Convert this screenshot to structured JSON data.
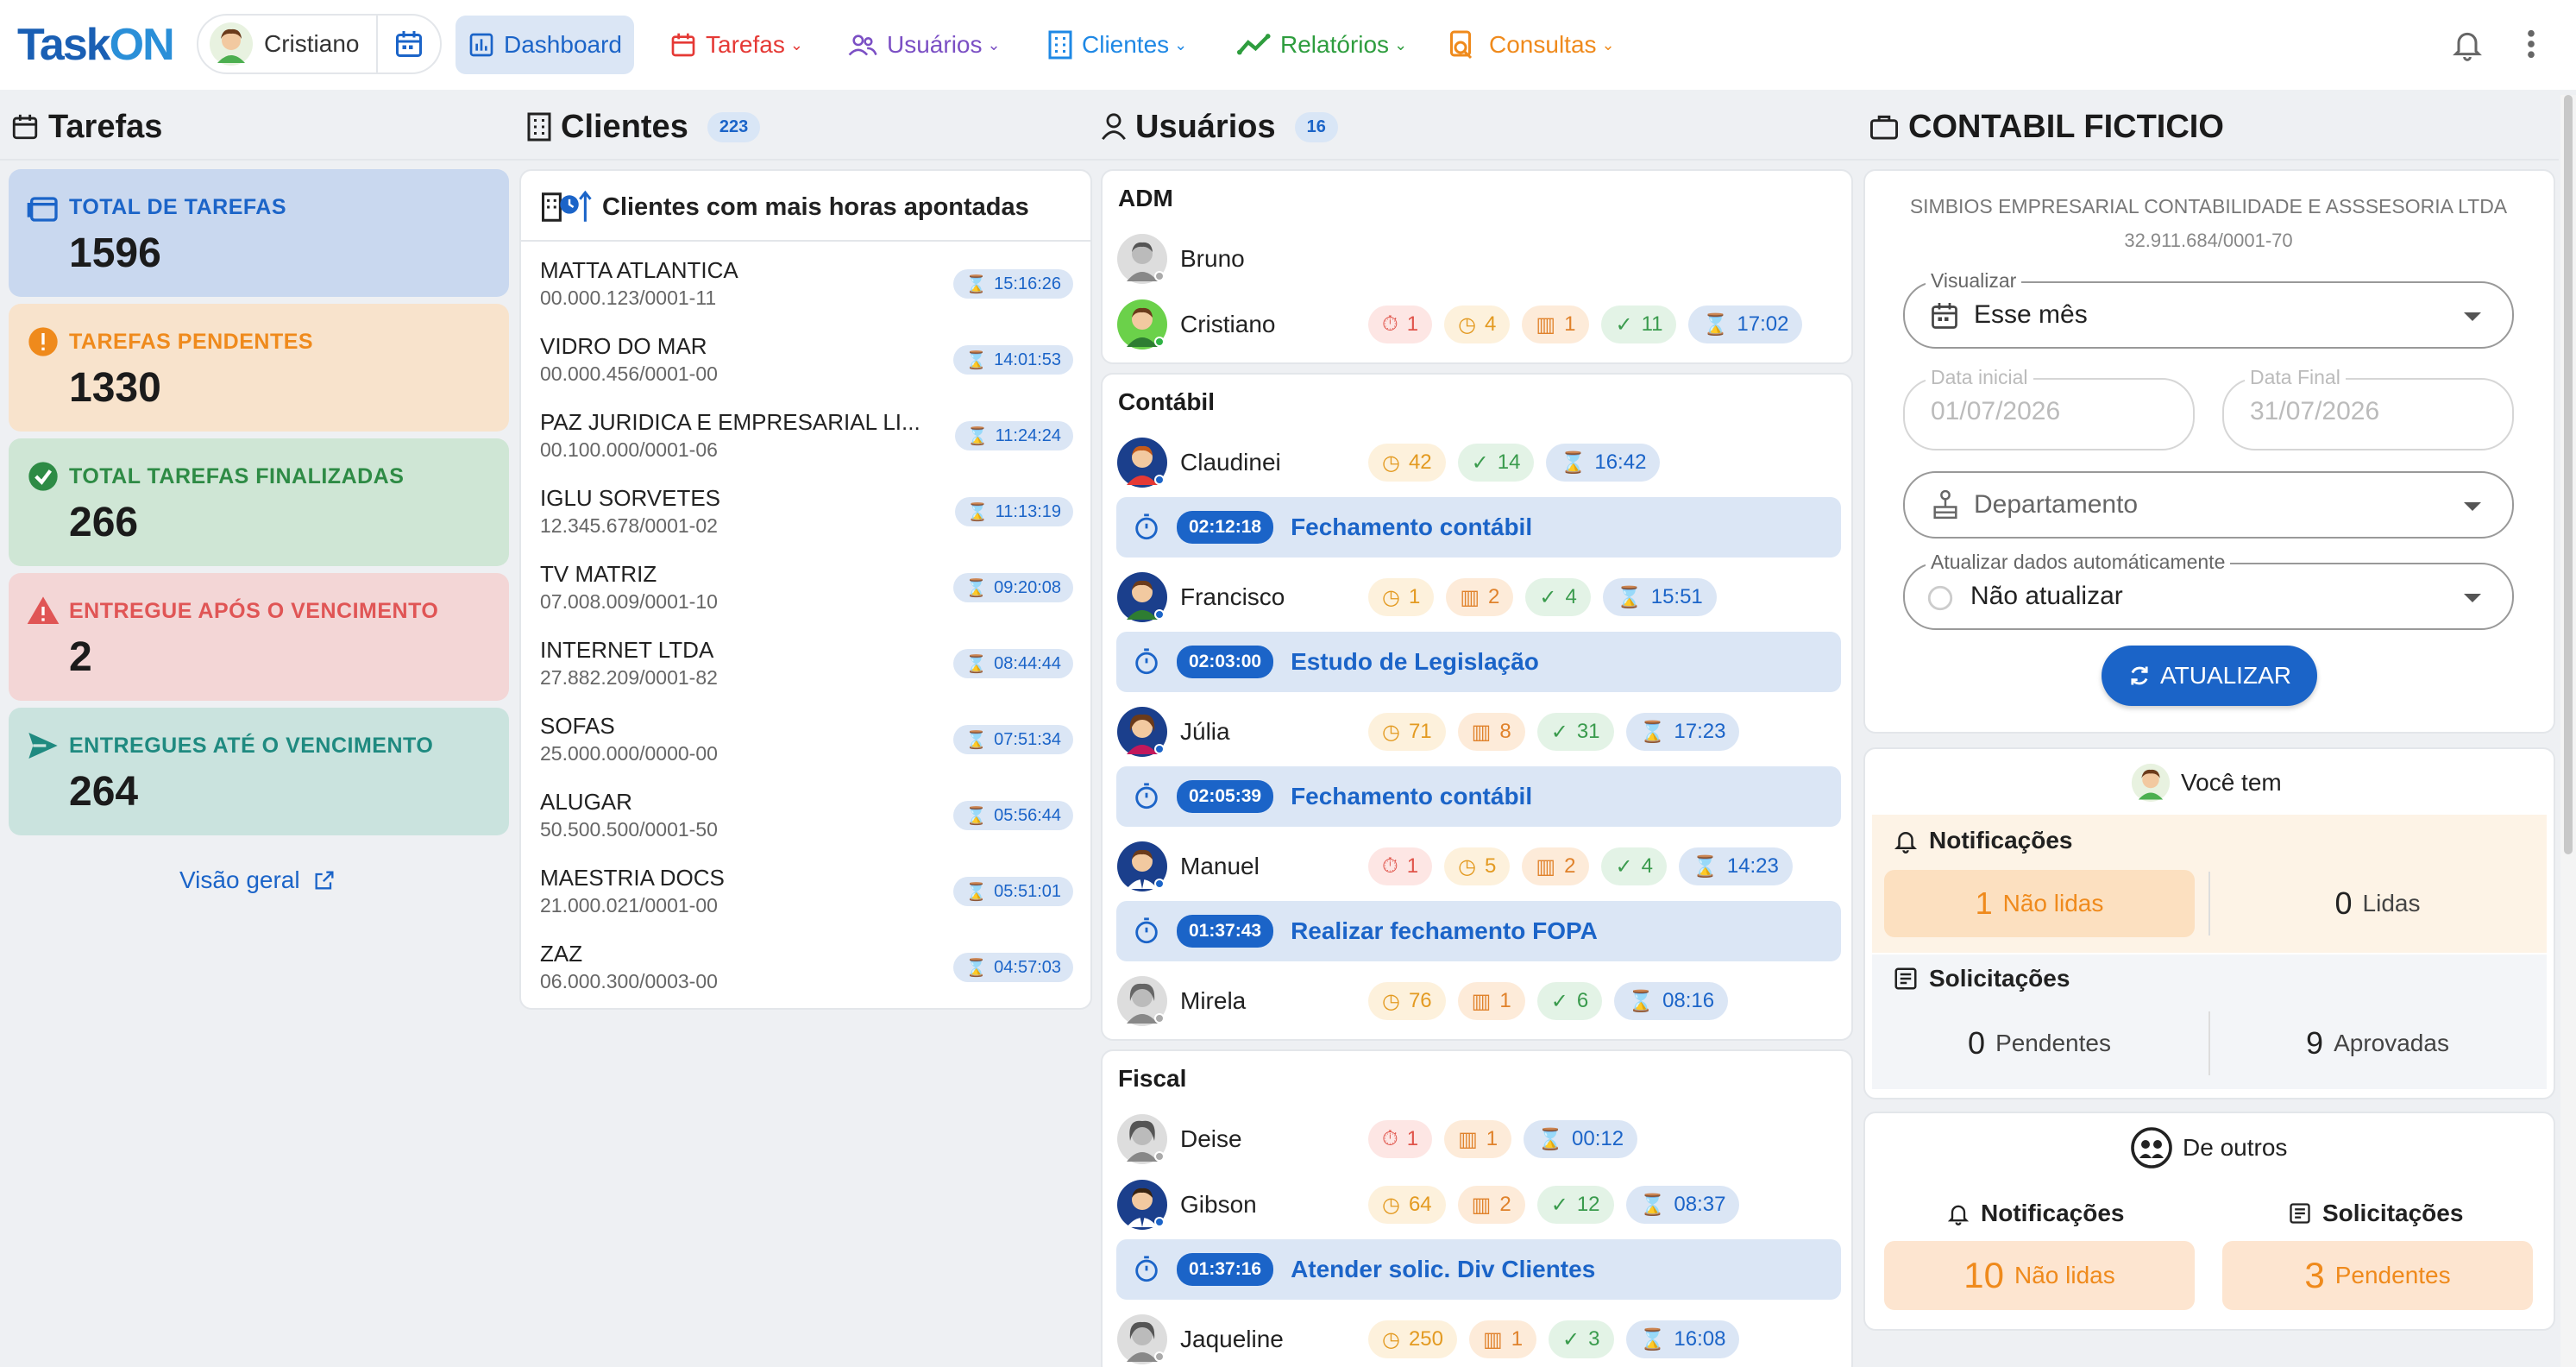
{
  "app": {
    "logo_part1": "Task",
    "logo_part2": "ON"
  },
  "user": {
    "name": "Cristiano"
  },
  "nav": [
    {
      "label": "Dashboard",
      "color": "#1b64c8"
    },
    {
      "label": "Tarefas",
      "color": "#e53935"
    },
    {
      "label": "Usuários",
      "color": "#7b4fc4"
    },
    {
      "label": "Clientes",
      "color": "#1e88e5"
    },
    {
      "label": "Relatórios",
      "color": "#2e9d3e"
    },
    {
      "label": "Consultas",
      "color": "#ef8a1c"
    }
  ],
  "tarefas": {
    "title": "Tarefas",
    "cards": [
      {
        "label": "TOTAL DE TAREFAS",
        "value": "1596",
        "color": "#1b64c8",
        "bg": "#c9d8ef"
      },
      {
        "label": "TAREFAS PENDENTES",
        "value": "1330",
        "color": "#ef8a1c",
        "bg": "#f8e3cc"
      },
      {
        "label": "TOTAL TAREFAS FINALIZADAS",
        "value": "266",
        "color": "#2e8b45",
        "bg": "#cfe6d5"
      },
      {
        "label": "ENTREGUE APÓS O VENCIMENTO",
        "value": "2",
        "color": "#e05555",
        "bg": "#f3d6d6"
      },
      {
        "label": "ENTREGUES ATÉ O VENCIMENTO",
        "value": "264",
        "color": "#1f8a80",
        "bg": "#cae3de"
      }
    ],
    "link": "Visão geral"
  },
  "clientes": {
    "title": "Clientes",
    "count": "223",
    "card_title": "Clientes com mais horas apontadas",
    "rows": [
      {
        "name": "MATTA ATLANTICA",
        "doc": "00.000.123/0001-11",
        "hours": "15:16:26"
      },
      {
        "name": "VIDRO DO MAR",
        "doc": "00.000.456/0001-00",
        "hours": "14:01:53"
      },
      {
        "name": "PAZ JURIDICA E EMPRESARIAL LI...",
        "doc": "00.100.000/0001-06",
        "hours": "11:24:24"
      },
      {
        "name": "IGLU SORVETES",
        "doc": "12.345.678/0001-02",
        "hours": "11:13:19"
      },
      {
        "name": "TV MATRIZ",
        "doc": "07.008.009/0001-10",
        "hours": "09:20:08"
      },
      {
        "name": "INTERNET LTDA",
        "doc": "27.882.209/0001-82",
        "hours": "08:44:44"
      },
      {
        "name": "SOFAS",
        "doc": "25.000.000/0000-00",
        "hours": "07:51:34"
      },
      {
        "name": "ALUGAR",
        "doc": "50.500.500/0001-50",
        "hours": "05:56:44"
      },
      {
        "name": "MAESTRIA DOCS",
        "doc": "21.000.021/0001-00",
        "hours": "05:51:01"
      },
      {
        "name": "ZAZ",
        "doc": "06.000.300/0003-00",
        "hours": "04:57:03"
      }
    ]
  },
  "usuarios": {
    "title": "Usuários",
    "count": "16",
    "groups": [
      {
        "name": "ADM"
      },
      {
        "name": "Contábil"
      },
      {
        "name": "Fiscal"
      }
    ],
    "people": {
      "bruno": {
        "name": "Bruno"
      },
      "cristiano": {
        "name": "Cristiano",
        "b": [
          "1",
          "4",
          "1",
          "11",
          "17:02"
        ]
      },
      "claudinei": {
        "name": "Claudinei",
        "b": [
          "42",
          "14",
          "16:42"
        ],
        "task_time": "02:12:18",
        "task": "Fechamento contábil"
      },
      "francisco": {
        "name": "Francisco",
        "b": [
          "1",
          "2",
          "4",
          "15:51"
        ],
        "task_time": "02:03:00",
        "task": "Estudo de Legislação"
      },
      "julia": {
        "name": "Júlia",
        "b": [
          "71",
          "8",
          "31",
          "17:23"
        ],
        "task_time": "02:05:39",
        "task": "Fechamento contábil"
      },
      "manuel": {
        "name": "Manuel",
        "b": [
          "1",
          "5",
          "2",
          "4",
          "14:23"
        ],
        "task_time": "01:37:43",
        "task": "Realizar fechamento FOPA"
      },
      "mirela": {
        "name": "Mirela",
        "b": [
          "76",
          "1",
          "6",
          "08:16"
        ]
      },
      "deise": {
        "name": "Deise",
        "b": [
          "1",
          "1",
          "00:12"
        ]
      },
      "gibson": {
        "name": "Gibson",
        "b": [
          "64",
          "2",
          "12",
          "08:37"
        ],
        "task_time": "01:37:16",
        "task": "Atender solic. Div Clientes"
      },
      "jaqueline": {
        "name": "Jaqueline",
        "b": [
          "250",
          "1",
          "3",
          "16:08"
        ]
      }
    }
  },
  "empresa": {
    "title": "CONTABIL FICTICIO",
    "company": "SIMBIOS EMPRESARIAL CONTABILIDADE E ASSSESORIA LTDA",
    "cnpj": "32.911.684/0001-70",
    "visualizar_label": "Visualizar",
    "visualizar_value": "Esse mês",
    "data_inicial_label": "Data inicial",
    "data_inicial_value": "01/07/2026",
    "data_final_label": "Data Final",
    "data_final_value": "31/07/2026",
    "departamento_placeholder": "Departamento",
    "atualizar_label": "Atualizar dados automáticamente",
    "atualizar_value": "Não atualizar",
    "button": "ATUALIZAR"
  },
  "voce_tem": {
    "title": "Você tem",
    "notif_title": "Notificações",
    "nao_lidas_num": "1",
    "nao_lidas": "Não lidas",
    "lidas_num": "0",
    "lidas": "Lidas",
    "solic_title": "Solicitações",
    "pend_num": "0",
    "pendentes": "Pendentes",
    "aprov_num": "9",
    "aprovadas": "Aprovadas"
  },
  "de_outros": {
    "title": "De outros",
    "notif_title": "Notificações",
    "solic_title": "Solicitações",
    "nao_lidas_num": "10",
    "nao_lidas": "Não lidas",
    "pend_num": "3",
    "pendentes": "Pendentes"
  }
}
